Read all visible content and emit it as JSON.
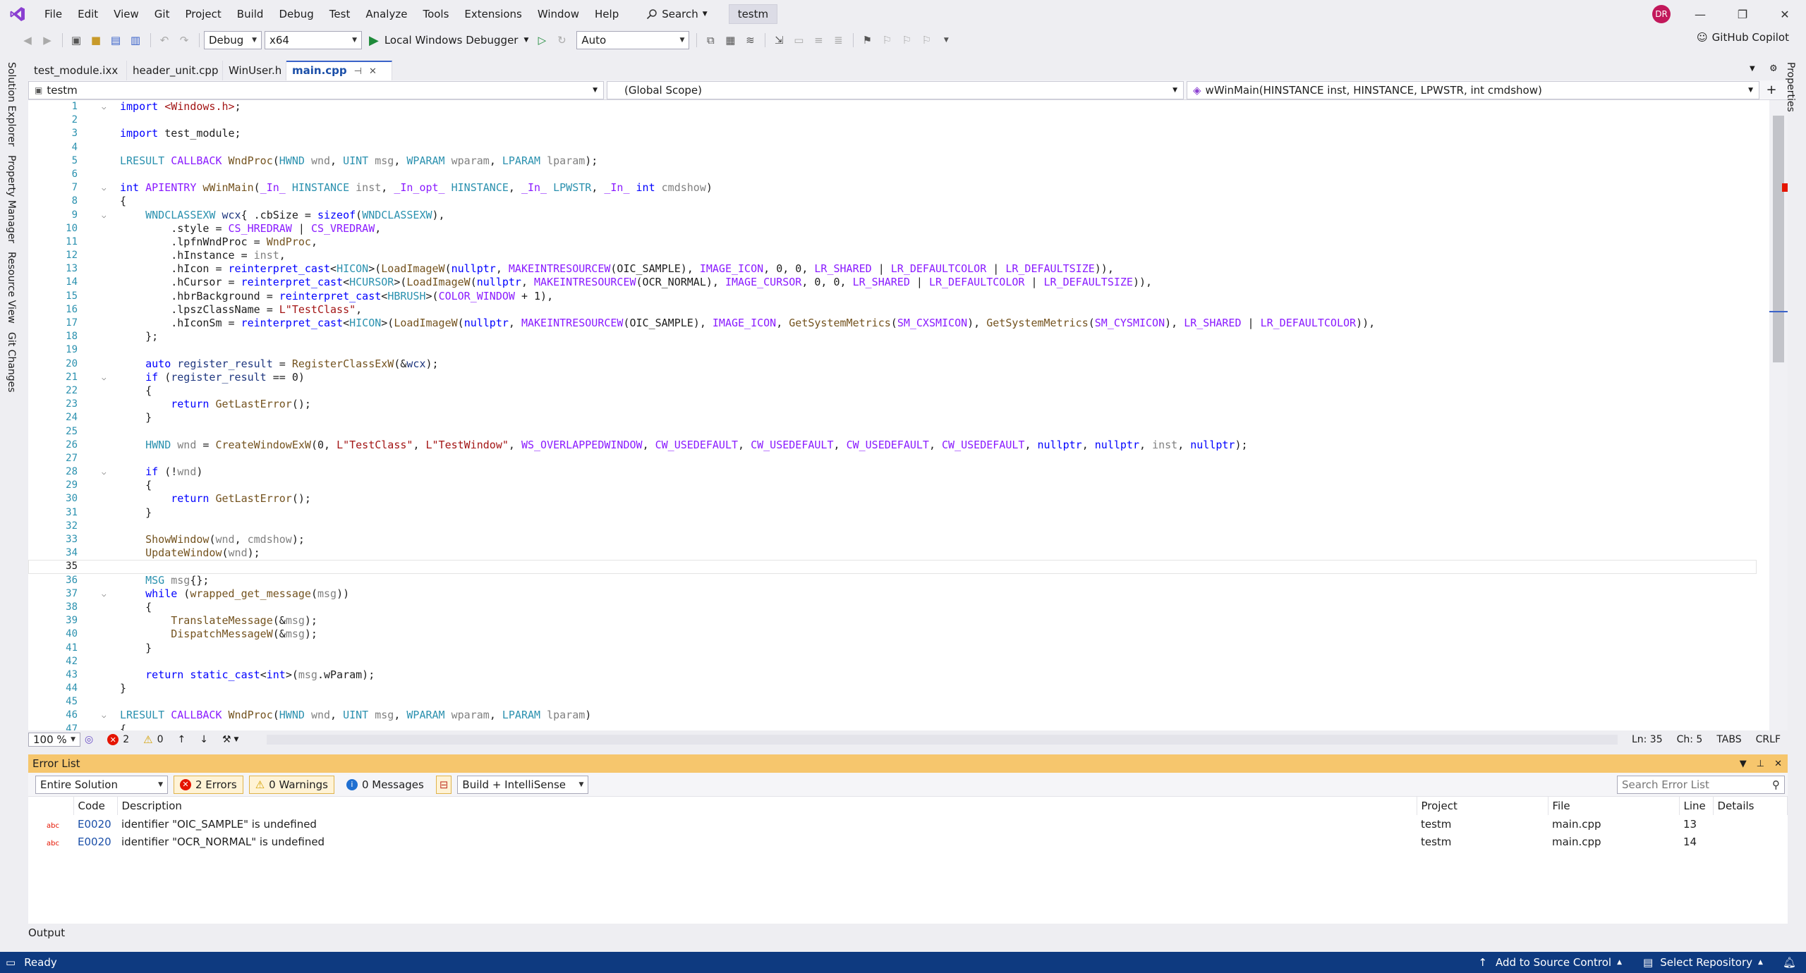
{
  "menubar": {
    "items": [
      "File",
      "Edit",
      "View",
      "Git",
      "Project",
      "Build",
      "Debug",
      "Test",
      "Analyze",
      "Tools",
      "Extensions",
      "Window",
      "Help"
    ],
    "search_label": "Search",
    "solution_name": "testm",
    "avatar_initials": "DR"
  },
  "toolbar": {
    "config": "Debug",
    "platform": "x64",
    "debugger": "Local Windows Debugger",
    "target": "Auto",
    "copilot_label": "GitHub Copilot"
  },
  "rails": {
    "left": [
      "Solution Explorer",
      "Property Manager",
      "Resource View",
      "Git Changes"
    ],
    "right": [
      "Properties"
    ]
  },
  "tabs": [
    {
      "label": "test_module.ixx",
      "active": false
    },
    {
      "label": "header_unit.cpp",
      "active": false
    },
    {
      "label": "WinUser.h",
      "active": false
    },
    {
      "label": "main.cpp",
      "active": true
    }
  ],
  "navbar": {
    "project": "testm",
    "scope": "(Global Scope)",
    "member": "wWinMain(HINSTANCE inst, HINSTANCE, LPWSTR, int cmdshow)"
  },
  "editor": {
    "current_line": 35,
    "lines": [
      {
        "n": 1,
        "fold": true,
        "t": "import <Windows.h>;"
      },
      {
        "n": 2,
        "t": ""
      },
      {
        "n": 3,
        "t": "import test_module;"
      },
      {
        "n": 4,
        "t": ""
      },
      {
        "n": 5,
        "t": "LRESULT CALLBACK WndProc(HWND wnd, UINT msg, WPARAM wparam, LPARAM lparam);"
      },
      {
        "n": 6,
        "t": ""
      },
      {
        "n": 7,
        "fold": true,
        "t": "int APIENTRY wWinMain(_In_ HINSTANCE inst, _In_opt_ HINSTANCE, _In_ LPWSTR, _In_ int cmdshow)"
      },
      {
        "n": 8,
        "t": "{"
      },
      {
        "n": 9,
        "fold": true,
        "t": "    WNDCLASSEXW wcx{ .cbSize = sizeof(WNDCLASSEXW),"
      },
      {
        "n": 10,
        "t": "        .style = CS_HREDRAW | CS_VREDRAW,"
      },
      {
        "n": 11,
        "t": "        .lpfnWndProc = WndProc,"
      },
      {
        "n": 12,
        "t": "        .hInstance = inst,"
      },
      {
        "n": 13,
        "t": "        .hIcon = reinterpret_cast<HICON>(LoadImageW(nullptr, MAKEINTRESOURCEW(OIC_SAMPLE), IMAGE_ICON, 0, 0, LR_SHARED | LR_DEFAULTCOLOR | LR_DEFAULTSIZE)),"
      },
      {
        "n": 14,
        "t": "        .hCursor = reinterpret_cast<HCURSOR>(LoadImageW(nullptr, MAKEINTRESOURCEW(OCR_NORMAL), IMAGE_CURSOR, 0, 0, LR_SHARED | LR_DEFAULTCOLOR | LR_DEFAULTSIZE)),"
      },
      {
        "n": 15,
        "t": "        .hbrBackground = reinterpret_cast<HBRUSH>(COLOR_WINDOW + 1),"
      },
      {
        "n": 16,
        "t": "        .lpszClassName = L\"TestClass\","
      },
      {
        "n": 17,
        "t": "        .hIconSm = reinterpret_cast<HICON>(LoadImageW(nullptr, MAKEINTRESOURCEW(OIC_SAMPLE), IMAGE_ICON, GetSystemMetrics(SM_CXSMICON), GetSystemMetrics(SM_CYSMICON), LR_SHARED | LR_DEFAULTCOLOR)),"
      },
      {
        "n": 18,
        "t": "    };"
      },
      {
        "n": 19,
        "t": ""
      },
      {
        "n": 20,
        "t": "    auto register_result = RegisterClassExW(&wcx);"
      },
      {
        "n": 21,
        "fold": true,
        "t": "    if (register_result == 0)"
      },
      {
        "n": 22,
        "t": "    {"
      },
      {
        "n": 23,
        "t": "        return GetLastError();"
      },
      {
        "n": 24,
        "t": "    }"
      },
      {
        "n": 25,
        "t": ""
      },
      {
        "n": 26,
        "t": "    HWND wnd = CreateWindowExW(0, L\"TestClass\", L\"TestWindow\", WS_OVERLAPPEDWINDOW, CW_USEDEFAULT, CW_USEDEFAULT, CW_USEDEFAULT, CW_USEDEFAULT, nullptr, nullptr, inst, nullptr);"
      },
      {
        "n": 27,
        "t": ""
      },
      {
        "n": 28,
        "fold": true,
        "t": "    if (!wnd)"
      },
      {
        "n": 29,
        "t": "    {"
      },
      {
        "n": 30,
        "t": "        return GetLastError();"
      },
      {
        "n": 31,
        "t": "    }"
      },
      {
        "n": 32,
        "t": ""
      },
      {
        "n": 33,
        "t": "    ShowWindow(wnd, cmdshow);"
      },
      {
        "n": 34,
        "t": "    UpdateWindow(wnd);"
      },
      {
        "n": 35,
        "t": ""
      },
      {
        "n": 36,
        "t": "    MSG msg{};"
      },
      {
        "n": 37,
        "fold": true,
        "t": "    while (wrapped_get_message(msg))"
      },
      {
        "n": 38,
        "t": "    {"
      },
      {
        "n": 39,
        "t": "        TranslateMessage(&msg);"
      },
      {
        "n": 40,
        "t": "        DispatchMessageW(&msg);"
      },
      {
        "n": 41,
        "t": "    }"
      },
      {
        "n": 42,
        "t": ""
      },
      {
        "n": 43,
        "t": "    return static_cast<int>(msg.wParam);"
      },
      {
        "n": 44,
        "t": "}"
      },
      {
        "n": 45,
        "t": ""
      },
      {
        "n": 46,
        "fold": true,
        "t": "LRESULT CALLBACK WndProc(HWND wnd, UINT msg, WPARAM wparam, LPARAM lparam)"
      },
      {
        "n": 47,
        "t": "{"
      }
    ]
  },
  "editor_status": {
    "zoom": "100 %",
    "errors": "2",
    "warnings": "0",
    "ln": "Ln: 35",
    "ch": "Ch: 5",
    "tabs": "TABS",
    "eol": "CRLF"
  },
  "error_list": {
    "title": "Error List",
    "scope": "Entire Solution",
    "errors_label": "2 Errors",
    "warnings_label": "0 Warnings",
    "messages_label": "0 Messages",
    "source": "Build + IntelliSense",
    "search_placeholder": "Search Error List",
    "columns": [
      "Code",
      "Description",
      "Project",
      "File",
      "Line",
      "Details"
    ],
    "rows": [
      {
        "code": "E0020",
        "description": "identifier \"OIC_SAMPLE\" is undefined",
        "project": "testm",
        "file": "main.cpp",
        "line": "13"
      },
      {
        "code": "E0020",
        "description": "identifier \"OCR_NORMAL\" is undefined",
        "project": "testm",
        "file": "main.cpp",
        "line": "14"
      }
    ]
  },
  "output_tab": "Output",
  "statusbar": {
    "ready": "Ready",
    "source_control": "Add to Source Control",
    "repository": "Select Repository"
  },
  "colors": {
    "keyword": "#0000ff",
    "type": "#2b91af",
    "macro": "#8a1bff",
    "function": "#74531f",
    "string": "#a31515",
    "param": "#808080",
    "variable": "#1f377f",
    "status_bar": "#0e3a80",
    "error_list_title": "#f6c66d"
  }
}
